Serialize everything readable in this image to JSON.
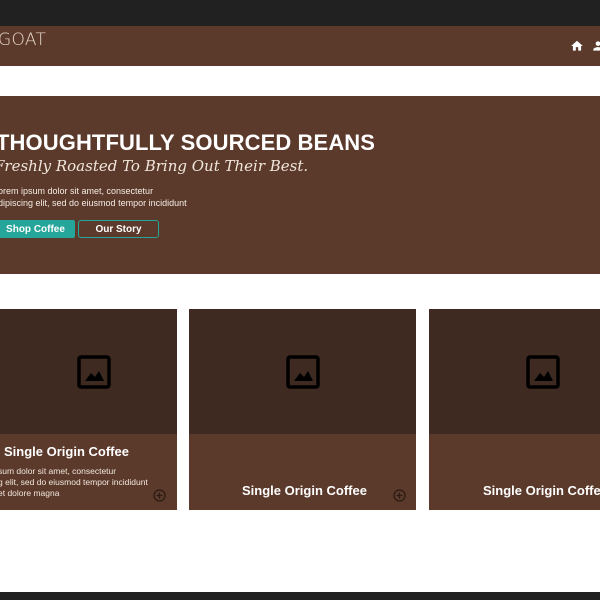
{
  "header": {
    "brand": "GOAT",
    "icons": [
      "home-icon",
      "person-icon"
    ]
  },
  "hero": {
    "title": "THOUGHTFULLY SOURCED BEANS",
    "subtitle": "Freshly Roasted To Bring Out Their Best.",
    "body_line1": "orem ipsum dolor sit amet, consectetur",
    "body_line2": "dipiscing elit, sed do eiusmod tempor incididunt",
    "primary_button": "Shop Coffee",
    "secondary_button": "Our Story"
  },
  "cards": [
    {
      "title": "Single Origin Coffee",
      "text_line1": "sum dolor sit amet, consectetur",
      "text_line2": "g elit, sed do eiusmod tempor incididunt",
      "text_line3": "et dolore magna",
      "icon": "image-placeholder-icon"
    },
    {
      "title": "Single Origin Coffee",
      "icon": "image-placeholder-icon"
    },
    {
      "title": "Single Origin Coffee",
      "icon": "image-placeholder-icon"
    }
  ],
  "colors": {
    "brown": "#5b3a2b",
    "dark_brown": "#3e2a20",
    "teal": "#26a69a",
    "bar": "#212121"
  }
}
